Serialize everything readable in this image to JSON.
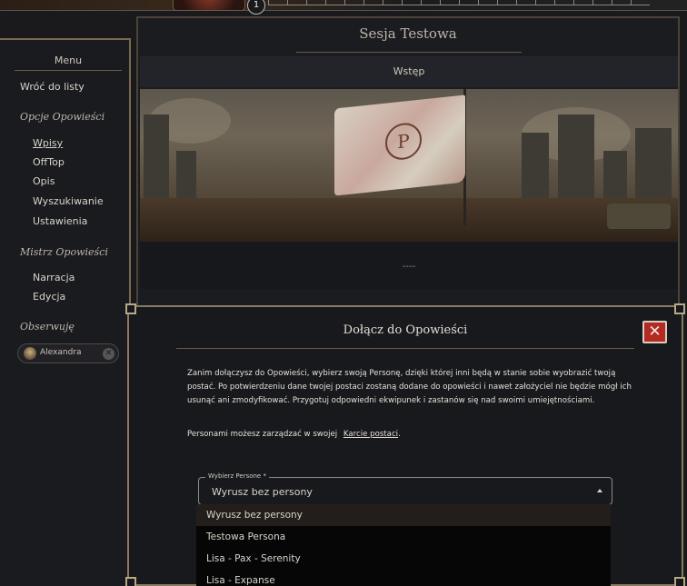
{
  "topbar": {
    "badge_count": "1"
  },
  "sidebar": {
    "title": "Menu",
    "back_link": "Wróć do listy",
    "section_story": "Opcje Opowieści",
    "story_items": [
      {
        "label": "Wpisy",
        "active": true
      },
      {
        "label": "OffTop",
        "active": false
      },
      {
        "label": "Opis",
        "active": false
      },
      {
        "label": "Wyszukiwanie",
        "active": false
      },
      {
        "label": "Ustawienia",
        "active": false
      }
    ],
    "section_master": "Mistrz Opowieści",
    "master_items": [
      {
        "label": "Narracja"
      },
      {
        "label": "Edycja"
      }
    ],
    "section_watch": "Obserwuję",
    "watch_chip": {
      "label": "Alexandra",
      "close_icon": "✕"
    }
  },
  "main": {
    "title": "Sesja Testowa",
    "subheader": "Wstęp",
    "flag_emblem": "P",
    "caption": "----"
  },
  "modal": {
    "title": "Dołącz do Opowieści",
    "close_icon": "✕",
    "body_text": "Zanim dołączysz do Opowieści, wybierz swoją Personę, dzięki której inni będą w stanie sobie wyobrazić twoją postać. Po potwierdzeniu dane twojej postaci zostaną dodane do opowieści i nawet założyciel nie będzie mógł ich usunąć ani zmodyfikować. Przygotuj odpowiedni ekwipunek i zastanów się nad swoimi umiejętnościami.",
    "note_prefix": "Personami możesz zarządzać w swojej",
    "note_link": "Karcie postaci",
    "note_suffix": ".",
    "select": {
      "legend": "Wybierz Persone *",
      "value": "Wyrusz bez persony"
    },
    "options": [
      {
        "label": "Wyrusz bez persony",
        "selected": true
      },
      {
        "label": "Testowa Persona",
        "selected": false
      },
      {
        "label": "Lisa - Pax - Serenity",
        "selected": false
      },
      {
        "label": "Lisa - Expanse",
        "selected": false
      }
    ]
  },
  "colors": {
    "accent_border": "#8a7a5e",
    "close_red": "#b32a22",
    "background": "#18191d"
  }
}
